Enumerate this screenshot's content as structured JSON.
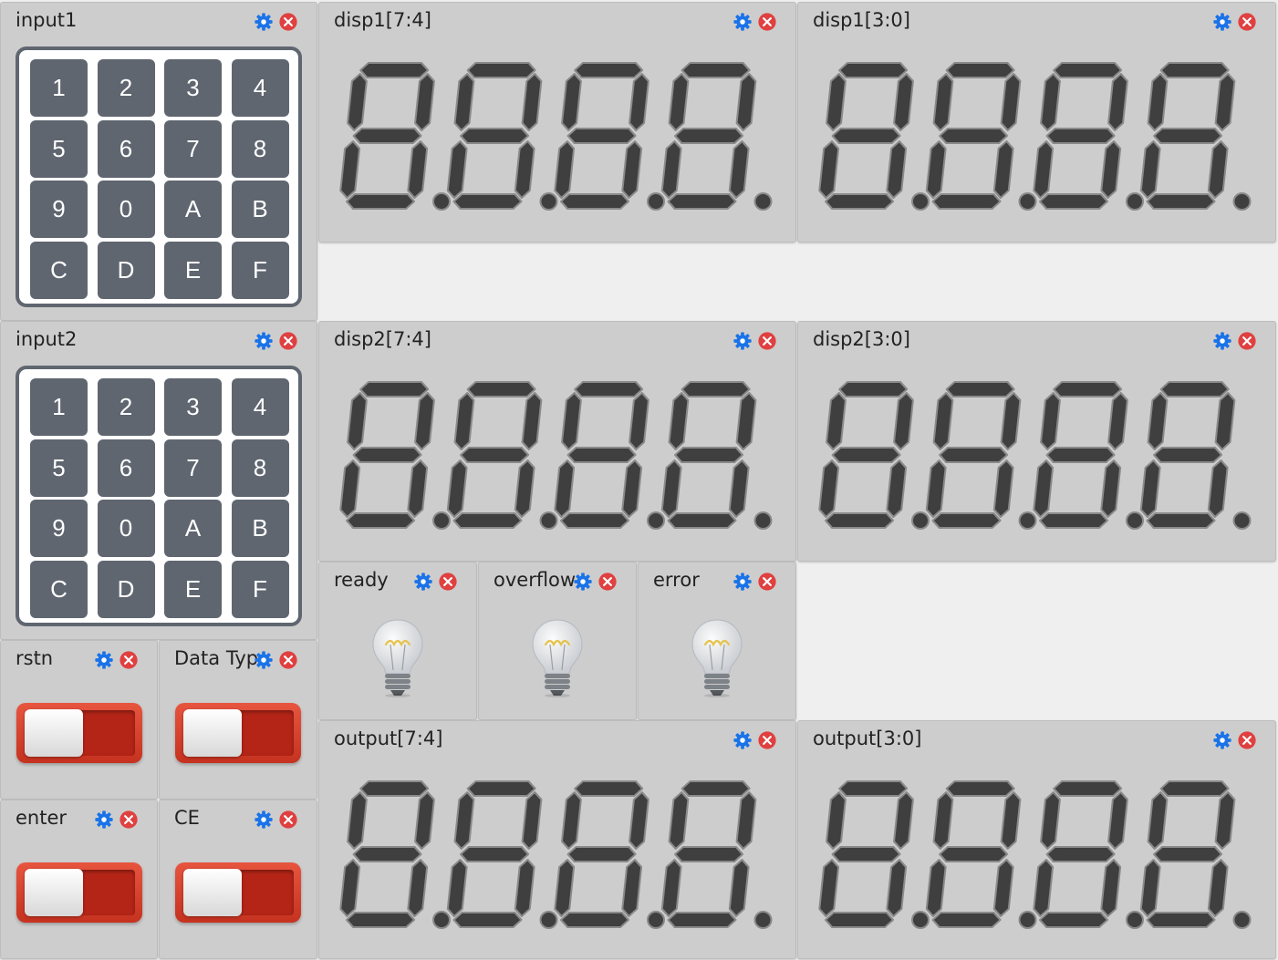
{
  "panels": {
    "input1": {
      "title": "input1",
      "keys": [
        "1",
        "2",
        "3",
        "4",
        "5",
        "6",
        "7",
        "8",
        "9",
        "0",
        "A",
        "B",
        "C",
        "D",
        "E",
        "F"
      ]
    },
    "input2": {
      "title": "input2",
      "keys": [
        "1",
        "2",
        "3",
        "4",
        "5",
        "6",
        "7",
        "8",
        "9",
        "0",
        "A",
        "B",
        "C",
        "D",
        "E",
        "F"
      ]
    },
    "disp1_hi": {
      "title": "disp1[7:4]"
    },
    "disp1_lo": {
      "title": "disp1[3:0]"
    },
    "disp2_hi": {
      "title": "disp2[7:4]"
    },
    "disp2_lo": {
      "title": "disp2[3:0]"
    },
    "output_hi": {
      "title": "output[7:4]"
    },
    "output_lo": {
      "title": "output[3:0]"
    },
    "ready": {
      "title": "ready"
    },
    "overflow": {
      "title": "overflow"
    },
    "error": {
      "title": "error"
    },
    "rstn": {
      "title": "rstn"
    },
    "data_type": {
      "title": "Data Typ"
    },
    "enter": {
      "title": "enter"
    },
    "ce": {
      "title": "CE"
    }
  },
  "colors": {
    "panel_bg": "#cdcdcd",
    "key_bg": "#5f6670",
    "segment_off": "#3f3f3f",
    "segment_outline": "#8a8a8a",
    "gear": "#1a73e8",
    "close": "#e04040",
    "switch_red": "#d8402a"
  },
  "icons": {
    "settings": "gear-icon",
    "remove": "close-icon",
    "lamp": "lightbulb-icon"
  }
}
